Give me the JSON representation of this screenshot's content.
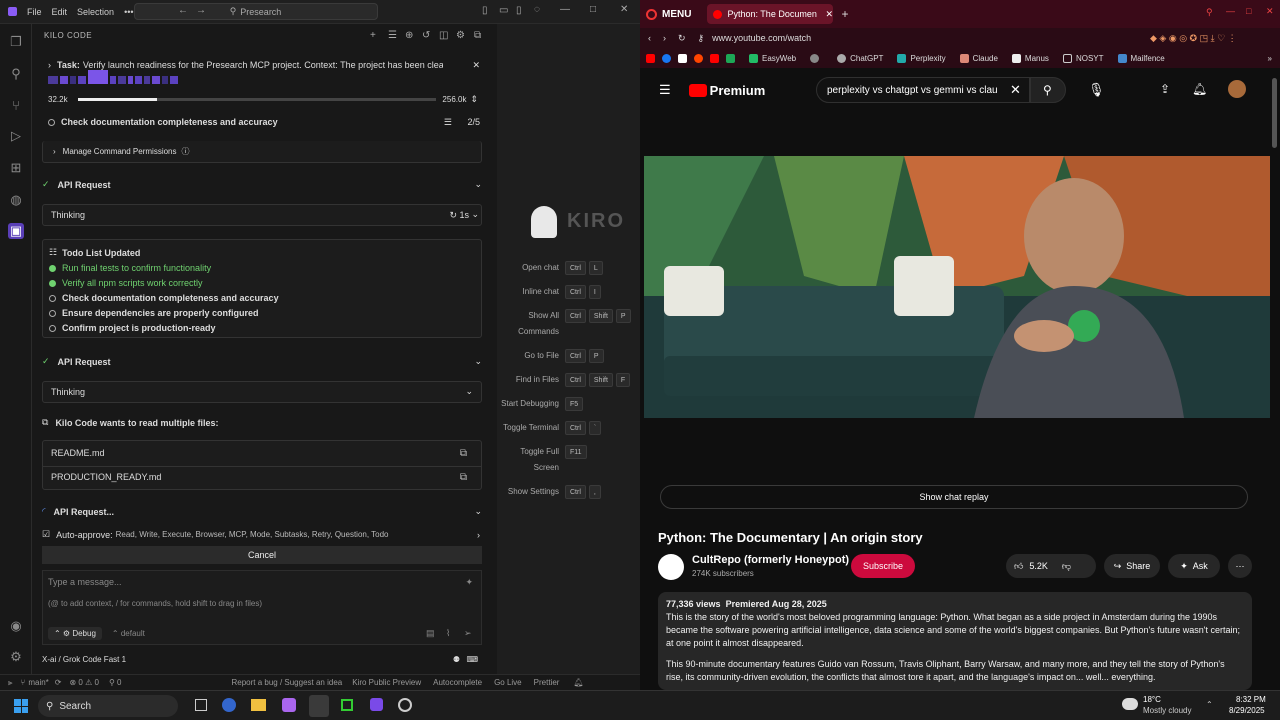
{
  "ide": {
    "menu": [
      "File",
      "Edit",
      "Selection",
      "•••"
    ],
    "search": "Presearch",
    "panel_title": "KILO CODE",
    "task_label": "Task:",
    "task_text": "Verify launch readiness for the Presearch MCP project. Context: The project has been cleaned, po...",
    "tokens_used": "32.2k",
    "tokens_max": "256.0k",
    "progress": 0.22,
    "current_todo": "Check documentation completeness and accuracy",
    "todo_count": "2/5",
    "manage_perms": "Manage Command Permissions",
    "api_request": "API Request",
    "thinking": "Thinking",
    "thinking_time": "1s",
    "todo_header": "Todo List Updated",
    "todos": [
      {
        "text": "Run final tests to confirm functionality",
        "done": true
      },
      {
        "text": "Verify all npm scripts work correctly",
        "done": true
      },
      {
        "text": "Check documentation completeness and accuracy",
        "done": false
      },
      {
        "text": "Ensure dependencies are properly configured",
        "done": false
      },
      {
        "text": "Confirm project is production-ready",
        "done": false
      }
    ],
    "api_request2": "API Request",
    "thinking2": "Thinking",
    "read_files_header": "Kilo Code wants to read multiple files:",
    "files": [
      "README.md",
      "PRODUCTION_READY.md"
    ],
    "api_request3": "API Request...",
    "auto_approve_label": "Auto-approve:",
    "auto_approve_text": "Read, Write, Execute, Browser, MCP, Mode, Subtasks, Retry, Question, Todo",
    "cancel": "Cancel",
    "msg_placeholder": "Type a message...",
    "msg_hint": "(@ to add context, / for commands, hold shift to drag in files)",
    "mode": "Debug",
    "profile": "default",
    "model": "X-ai / Grok Code Fast 1"
  },
  "kiro": {
    "logo": "KIRO",
    "shortcuts": [
      {
        "label": "Open chat",
        "keys": [
          "Ctrl",
          "L"
        ]
      },
      {
        "label": "Inline chat",
        "keys": [
          "Ctrl",
          "I"
        ]
      },
      {
        "label": "Show All Commands",
        "keys": [
          "Ctrl",
          "Shift",
          "P"
        ]
      },
      {
        "label": "Go to File",
        "keys": [
          "Ctrl",
          "P"
        ]
      },
      {
        "label": "Find in Files",
        "keys": [
          "Ctrl",
          "Shift",
          "F"
        ]
      },
      {
        "label": "Start Debugging",
        "keys": [
          "F5"
        ]
      },
      {
        "label": "Toggle Terminal",
        "keys": [
          "Ctrl",
          "`"
        ]
      },
      {
        "label": "Toggle Full Screen",
        "keys": [
          "F11"
        ]
      },
      {
        "label": "Show Settings",
        "keys": [
          "Ctrl",
          ","
        ]
      }
    ]
  },
  "statusbar": {
    "branch": "main*",
    "problems": "⊗ 0 ⚠ 0",
    "ports": "⚲ 0",
    "report": "Report a bug / Suggest an idea",
    "kiro_preview": "Kiro Public Preview",
    "autocomplete": "Autocomplete",
    "golive": "Go Live",
    "prettier": "Prettier"
  },
  "browser": {
    "menu": "MENU",
    "tab_title": "Python: The Documen",
    "url": "www.youtube.com/watch",
    "bookmarks": [
      "EasyWeb",
      "ChatGPT",
      "Perplexity",
      "Claude",
      "Manus",
      "NOSYT",
      "Mailfence"
    ],
    "brand": "Premium",
    "search_query": "perplexity vs chatgpt vs gemmi vs clau",
    "chat_replay": "Show chat replay",
    "video_title": "Python: The Documentary | An origin story",
    "channel": "CultRepo (formerly Honeypot)",
    "subscribers": "274K subscribers",
    "subscribe": "Subscribe",
    "likes": "5.2K",
    "share": "Share",
    "ask": "Ask",
    "views": "77,336 views",
    "premiered": "Premiered Aug 28, 2025",
    "desc1": "This is the story of the world's most beloved programming language: Python. What began as a side project in Amsterdam during the 1990s became the software powering artificial intelligence, data science and some of the world's biggest companies. But Python's future wasn't certain; at one point it almost disappeared.",
    "desc2": "This 90-minute documentary features Guido van Rossum, Travis Oliphant, Barry Warsaw, and many more, and they tell the story of Python's rise, its community-driven evolution, the conflicts that almost tore it apart, and the language's impact on... well... everything."
  },
  "taskbar": {
    "search": "Search",
    "weather_temp": "18°C",
    "weather_desc": "Mostly cloudy",
    "time": "8:32 PM",
    "date": "8/29/2025"
  }
}
